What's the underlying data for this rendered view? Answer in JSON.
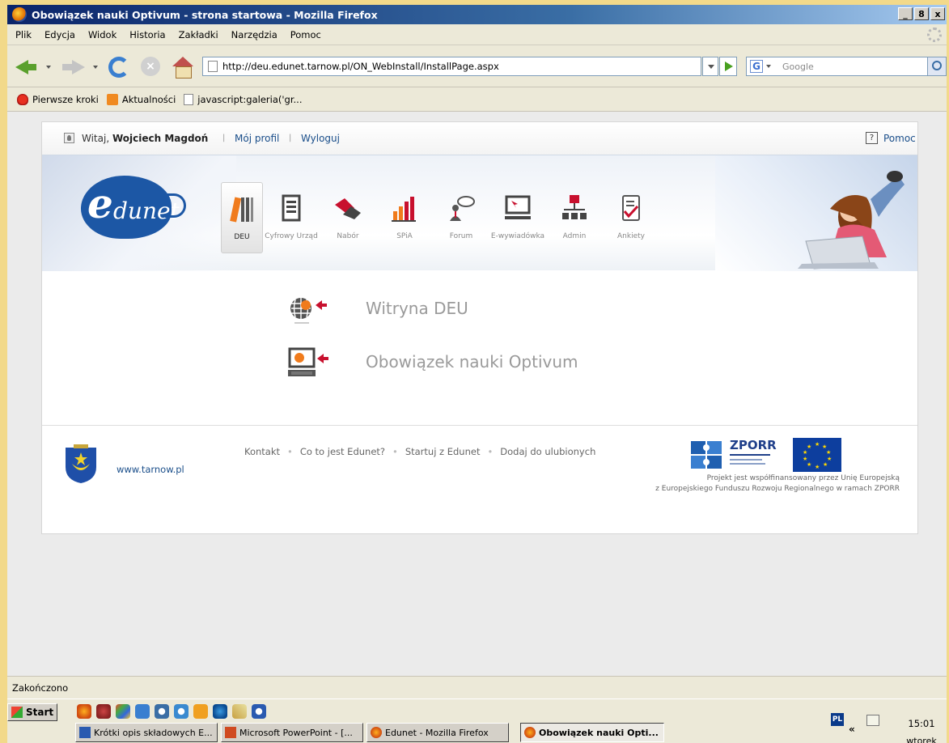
{
  "window": {
    "title": "Obowiązek nauki Optivum - strona startowa - Mozilla Firefox",
    "controls": [
      "_",
      "8",
      "x"
    ]
  },
  "menu": [
    "Plik",
    "Edycja",
    "Widok",
    "Historia",
    "Zakładki",
    "Narzędzia",
    "Pomoc"
  ],
  "address": {
    "url": "http://deu.edunet.tarnow.pl/ON_WebInstall/InstallPage.aspx",
    "search_placeholder": "Google"
  },
  "bookmarks": [
    "Pierwsze kroki",
    "Aktualności",
    "javascript:galeria('gr..."
  ],
  "userbar": {
    "welcome": "Witaj, ",
    "user": "Wojciech Magdoń",
    "profile": "Mój profil",
    "logout": "Wyloguj",
    "help": "Pomoc",
    "help_icon": "?"
  },
  "logo": {
    "e": "e",
    "text": "dunet"
  },
  "modules": [
    {
      "label": "DEU",
      "icon": "books-icon"
    },
    {
      "label": "Cyfrowy Urząd",
      "icon": "document-icon"
    },
    {
      "label": "Nabór",
      "icon": "handshake-icon"
    },
    {
      "label": "SPiA",
      "icon": "bar-chart-icon"
    },
    {
      "label": "Forum",
      "icon": "forum-icon"
    },
    {
      "label": "E-wywiadówka",
      "icon": "monitor-icon"
    },
    {
      "label": "Admin",
      "icon": "org-chart-icon"
    },
    {
      "label": "Ankiety",
      "icon": "survey-icon"
    }
  ],
  "main_links": [
    "Witryna DEU",
    "Obowiązek nauki Optivum"
  ],
  "footer": {
    "www": "www.tarnow.pl",
    "links": [
      "Kontakt",
      "Co to jest Edunet?",
      "Startuj z Edunet",
      "Dodaj do ulubionych"
    ],
    "separator": "•",
    "zporr": "ZPORR",
    "project_line1": "Projekt jest współfinansowany przez Unię Europejską",
    "project_line2": "z Europejskiego Funduszu Rozwoju Regionalnego w ramach ZPORR"
  },
  "status": "Zakończono",
  "taskbar": {
    "start": "Start",
    "tasks": [
      "Krótki opis składowych E...",
      "Microsoft PowerPoint - [...",
      "Edunet - Mozilla Firefox",
      "Obowiązek nauki Opti..."
    ],
    "lang": "PL",
    "chevron": "«",
    "time": "15:01",
    "day": "wtorek"
  },
  "colors": {
    "brand_blue": "#1c57a5",
    "accent_red": "#c8102e",
    "accent_orange": "#f07b1c"
  }
}
